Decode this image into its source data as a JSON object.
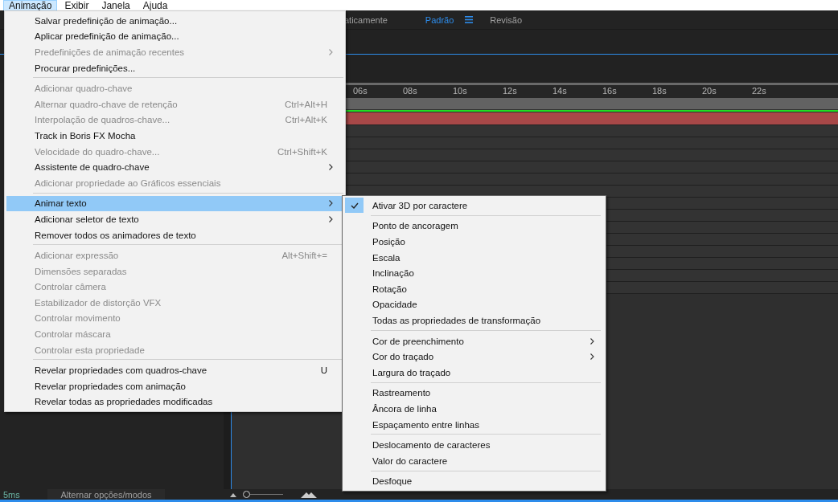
{
  "menubar": [
    {
      "label": "Animação",
      "selected": true
    },
    {
      "label": "Exibir",
      "selected": false
    },
    {
      "label": "Janela",
      "selected": false
    },
    {
      "label": "Ajuda",
      "selected": false
    }
  ],
  "workspaces": [
    {
      "label": "aticamente",
      "selected": false,
      "menu_icon": false
    },
    {
      "label": "Padrão",
      "selected": true,
      "menu_icon": true
    },
    {
      "label": "Revisão",
      "selected": false,
      "menu_icon": false
    }
  ],
  "timeline": {
    "ruler": [
      "06s",
      "08s",
      "10s",
      "12s",
      "14s",
      "16s",
      "18s",
      "20s",
      "22s"
    ]
  },
  "status_bar": {
    "time": "5ms",
    "toggle_button": "Alternar opções/modos",
    "zoom": {
      "level": 0.05
    }
  },
  "menu": [
    {
      "kind": "item",
      "label": "Salvar predefinição de animação...",
      "disabled": false,
      "submenu": false,
      "selected": false
    },
    {
      "kind": "item",
      "label": "Aplicar predefinição de animação...",
      "disabled": false,
      "submenu": false,
      "selected": false
    },
    {
      "kind": "item",
      "label": "Predefinições de animação recentes",
      "disabled": true,
      "submenu": true,
      "selected": false
    },
    {
      "kind": "item",
      "label": "Procurar predefinições...",
      "disabled": false,
      "submenu": false,
      "selected": false
    },
    {
      "kind": "separator"
    },
    {
      "kind": "item",
      "label": "Adicionar quadro-chave",
      "disabled": true,
      "submenu": false,
      "selected": false
    },
    {
      "kind": "item",
      "label": "Alternar quadro-chave de retenção",
      "disabled": true,
      "submenu": false,
      "selected": false,
      "shortcut": "Ctrl+Alt+H"
    },
    {
      "kind": "item",
      "label": "Interpolação de quadros-chave...",
      "disabled": true,
      "submenu": false,
      "selected": false,
      "shortcut": "Ctrl+Alt+K"
    },
    {
      "kind": "item",
      "label": "Track in Boris FX Mocha",
      "disabled": false,
      "submenu": false,
      "selected": false
    },
    {
      "kind": "item",
      "label": "Velocidade do quadro-chave...",
      "disabled": true,
      "submenu": false,
      "selected": false,
      "shortcut": "Ctrl+Shift+K"
    },
    {
      "kind": "item",
      "label": "Assistente de quadro-chave",
      "disabled": false,
      "submenu": true,
      "selected": false
    },
    {
      "kind": "item",
      "label": "Adicionar propriedade ao Gráficos essenciais",
      "disabled": true,
      "submenu": false,
      "selected": false
    },
    {
      "kind": "separator"
    },
    {
      "kind": "item",
      "label": "Animar texto",
      "disabled": false,
      "submenu": true,
      "selected": true
    },
    {
      "kind": "item",
      "label": "Adicionar seletor de texto",
      "disabled": false,
      "submenu": true,
      "selected": false
    },
    {
      "kind": "item",
      "label": "Remover todos os animadores de texto",
      "disabled": false,
      "submenu": false,
      "selected": false
    },
    {
      "kind": "separator"
    },
    {
      "kind": "item",
      "label": "Adicionar expressão",
      "disabled": true,
      "submenu": false,
      "selected": false,
      "shortcut": "Alt+Shift+="
    },
    {
      "kind": "item",
      "label": "Dimensões separadas",
      "disabled": true,
      "submenu": false,
      "selected": false
    },
    {
      "kind": "item",
      "label": "Controlar câmera",
      "disabled": true,
      "submenu": false,
      "selected": false
    },
    {
      "kind": "item",
      "label": "Estabilizador de distorção VFX",
      "disabled": true,
      "submenu": false,
      "selected": false
    },
    {
      "kind": "item",
      "label": "Controlar movimento",
      "disabled": true,
      "submenu": false,
      "selected": false
    },
    {
      "kind": "item",
      "label": "Controlar máscara",
      "disabled": true,
      "submenu": false,
      "selected": false
    },
    {
      "kind": "item",
      "label": "Controlar esta propriedade",
      "disabled": true,
      "submenu": false,
      "selected": false
    },
    {
      "kind": "separator"
    },
    {
      "kind": "item",
      "label": "Revelar propriedades com quadros-chave",
      "disabled": false,
      "submenu": false,
      "selected": false,
      "shortcut": "U"
    },
    {
      "kind": "item",
      "label": "Revelar propriedades com animação",
      "disabled": false,
      "submenu": false,
      "selected": false
    },
    {
      "kind": "item",
      "label": "Revelar todas as propriedades modificadas",
      "disabled": false,
      "submenu": false,
      "selected": false
    }
  ],
  "submenu": [
    {
      "kind": "item",
      "label": "Ativar 3D por caractere",
      "checked": true,
      "submenu": false
    },
    {
      "kind": "separator"
    },
    {
      "kind": "item",
      "label": "Ponto de ancoragem",
      "checked": false,
      "submenu": false
    },
    {
      "kind": "item",
      "label": "Posição",
      "checked": false,
      "submenu": false
    },
    {
      "kind": "item",
      "label": "Escala",
      "checked": false,
      "submenu": false
    },
    {
      "kind": "item",
      "label": "Inclinação",
      "checked": false,
      "submenu": false
    },
    {
      "kind": "item",
      "label": "Rotação",
      "checked": false,
      "submenu": false
    },
    {
      "kind": "item",
      "label": "Opacidade",
      "checked": false,
      "submenu": false
    },
    {
      "kind": "item",
      "label": "Todas as propriedades de transformação",
      "checked": false,
      "submenu": false
    },
    {
      "kind": "separator"
    },
    {
      "kind": "item",
      "label": "Cor de preenchimento",
      "checked": false,
      "submenu": true
    },
    {
      "kind": "item",
      "label": "Cor do traçado",
      "checked": false,
      "submenu": true
    },
    {
      "kind": "item",
      "label": "Largura do traçado",
      "checked": false,
      "submenu": false
    },
    {
      "kind": "separator"
    },
    {
      "kind": "item",
      "label": "Rastreamento",
      "checked": false,
      "submenu": false
    },
    {
      "kind": "item",
      "label": "Âncora de linha",
      "checked": false,
      "submenu": false
    },
    {
      "kind": "item",
      "label": "Espaçamento entre linhas",
      "checked": false,
      "submenu": false
    },
    {
      "kind": "separator"
    },
    {
      "kind": "item",
      "label": "Deslocamento de caracteres",
      "checked": false,
      "submenu": false
    },
    {
      "kind": "item",
      "label": "Valor do caractere",
      "checked": false,
      "submenu": false
    },
    {
      "kind": "separator"
    },
    {
      "kind": "item",
      "label": "Desfoque",
      "checked": false,
      "submenu": false
    }
  ]
}
